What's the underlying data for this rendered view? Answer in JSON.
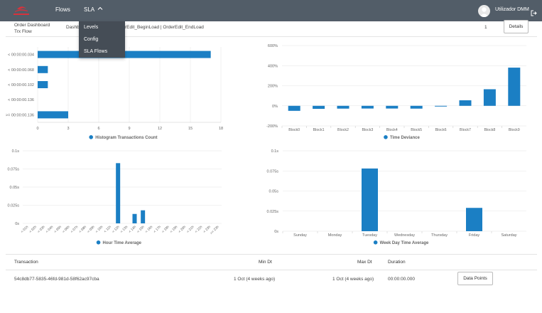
{
  "nav": {
    "flows": "Flows",
    "sla": "SLA",
    "user": "Utilizador DMM"
  },
  "sla_menu": [
    "Levels",
    "Config",
    "SLA Flows"
  ],
  "header": {
    "title_line1": "Order Dashboard",
    "title_line2": "Trx Flow",
    "crumb_a": "Dashb",
    "crumb_b": "rEdit_BeginLoad | OrderEdit_EndLoad",
    "count": "1",
    "details": "Details"
  },
  "colors": {
    "navbar": "#525d68",
    "bar": "#1b7fc4",
    "brand": "#d8323c"
  },
  "icons": {
    "logout": "logout-icon",
    "avatar": "user-avatar",
    "chevron": "chevron-up-icon"
  },
  "chart_data": [
    {
      "type": "bar",
      "orientation": "horizontal",
      "categories": [
        "< 00:00:00.034",
        "< 00:00:00.068",
        "< 00:00:00.102",
        "< 00:00:00.136",
        ">= 00:00:00.136"
      ],
      "values": [
        17,
        1,
        1,
        0,
        3
      ],
      "xticks": [
        "0",
        "3",
        "6",
        "9",
        "12",
        "15",
        "18"
      ],
      "xlim": [
        0,
        18
      ],
      "legend": "Histogram Transactions Count",
      "legend_position": "bottom"
    },
    {
      "type": "bar",
      "categories": [
        "Block0",
        "Block1",
        "Block2",
        "Block3",
        "Block4",
        "Block5",
        "Block6",
        "Block7",
        "Block8",
        "Block9"
      ],
      "values": [
        -50,
        -30,
        -28,
        -27,
        -27,
        -28,
        -3,
        55,
        165,
        380
      ],
      "yticks": [
        "600%",
        "400%",
        "200%",
        "0%",
        "-200%"
      ],
      "ylim": [
        -200,
        600
      ],
      "legend": "Time Deviance",
      "legend_position": "bottom"
    },
    {
      "type": "bar",
      "categories": [
        "< 01h",
        "< 02h",
        "< 03h",
        "< 04h",
        "< 05h",
        "< 06h",
        "< 07h",
        "< 08h",
        "< 09h",
        "< 10h",
        "< 11h",
        "< 12h",
        "< 13h",
        "< 14h",
        "< 15h",
        "< 16h",
        "< 17h",
        "< 18h",
        "< 19h",
        "< 20h",
        "< 21h",
        "< 22h",
        "< 23h",
        ">= 23h"
      ],
      "values": [
        0,
        0,
        0,
        0,
        0,
        0,
        0,
        0,
        0,
        0,
        0,
        0.083,
        0,
        0.013,
        0.018,
        0,
        0,
        0,
        0,
        0,
        0,
        0,
        0,
        0
      ],
      "yticks": [
        "0.1s",
        "0.075s",
        "0.05s",
        "0.025s",
        "0s"
      ],
      "ylim": [
        0,
        0.1
      ],
      "legend": "Hour Time Average",
      "legend_position": "bottom"
    },
    {
      "type": "bar",
      "categories": [
        "Sunday",
        "Monday",
        "Tuesday",
        "Wednesday",
        "Thursday",
        "Friday",
        "Saturday"
      ],
      "values": [
        0,
        0,
        0.078,
        0,
        0,
        0.029,
        0
      ],
      "yticks": [
        "0.1s",
        "0.075s",
        "0.05s",
        "0.025s",
        "0s"
      ],
      "ylim": [
        0,
        0.1
      ],
      "legend": "Week Day Time Average",
      "legend_position": "bottom"
    }
  ],
  "table": {
    "headers": [
      "Transaction",
      "Min Dt",
      "Max Dt",
      "Duration"
    ],
    "row": {
      "transaction": "54c8db77-5835-46fd-981d-58f62ac97cba",
      "min_dt": "1 Oct (4 weeks ago)",
      "max_dt": "1 Oct (4 weeks ago)",
      "duration": "00:00:00.000",
      "action": "Data Points"
    }
  }
}
